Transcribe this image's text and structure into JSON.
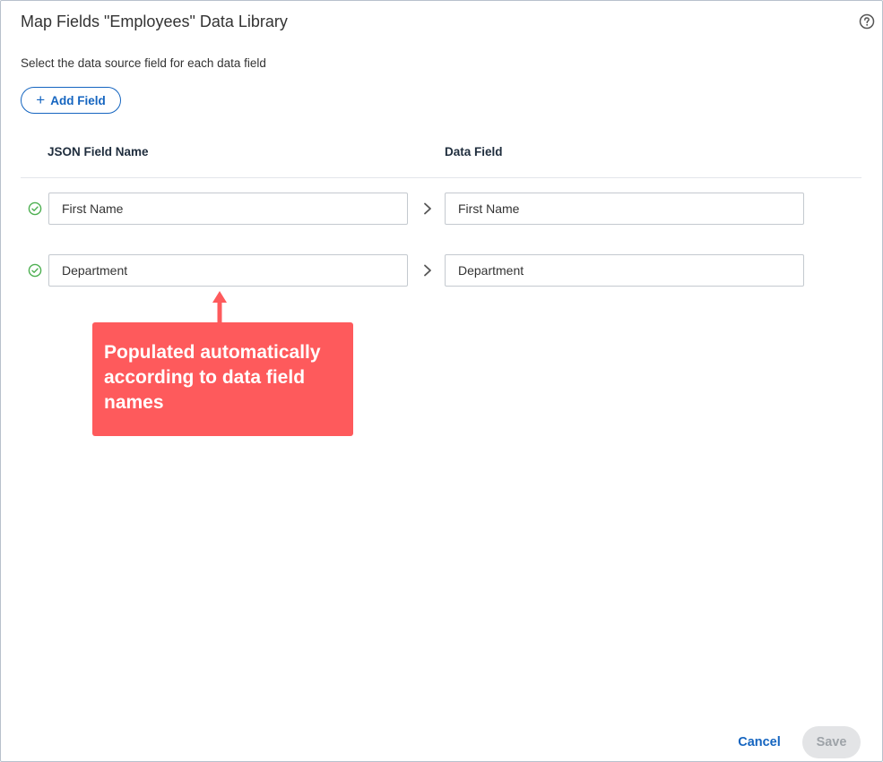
{
  "dialog": {
    "title": "Map Fields \"Employees\" Data Library",
    "subtitle": "Select the data source field for each data field",
    "help_icon": "question-circle-icon"
  },
  "toolbar": {
    "add_field_label": "Add Field",
    "add_field_icon": "plus-icon"
  },
  "columns": {
    "json_field_name": "JSON Field Name",
    "data_field": "Data Field"
  },
  "rows": [
    {
      "status_icon": "check-circle-icon",
      "json_field": "First Name",
      "data_field": "First Name"
    },
    {
      "status_icon": "check-circle-icon",
      "json_field": "Department",
      "data_field": "Department"
    }
  ],
  "callout": {
    "text": "Populated automatically according to data field names",
    "color": "#fe5a5c"
  },
  "footer": {
    "cancel_label": "Cancel",
    "save_label": "Save"
  },
  "colors": {
    "accent": "#1565c0",
    "success": "#4caf50",
    "disabled_bg": "#e3e4e6"
  }
}
